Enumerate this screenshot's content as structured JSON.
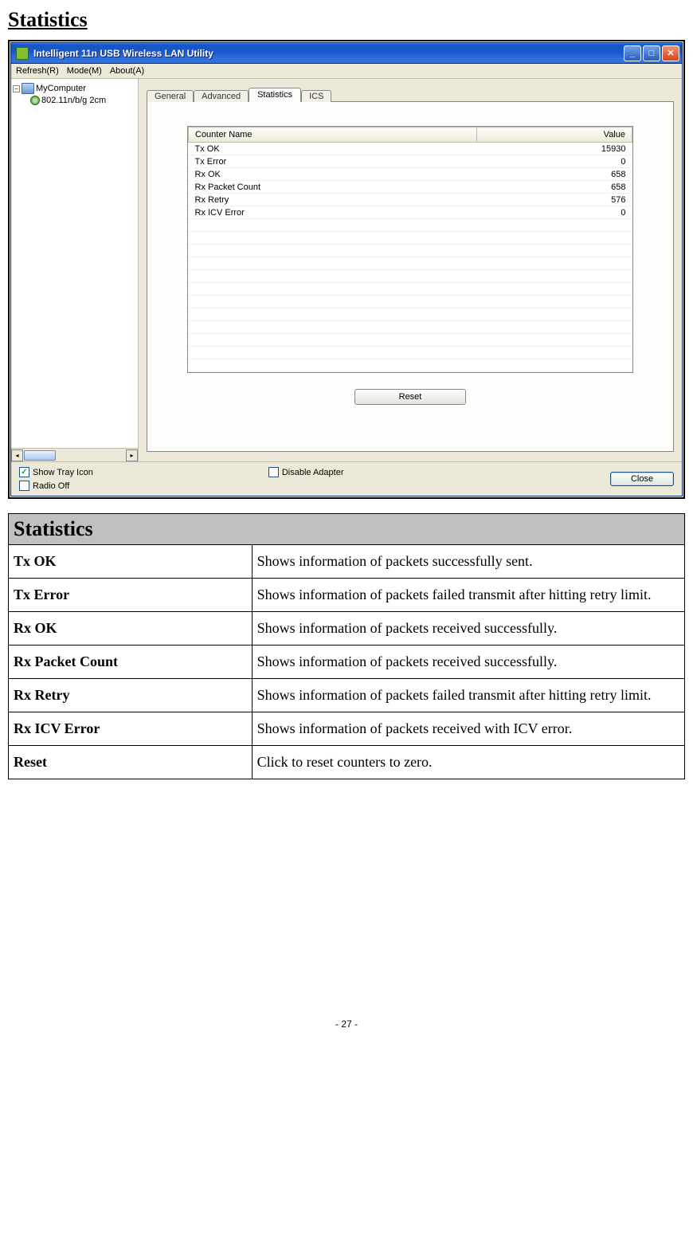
{
  "page": {
    "heading": "Statistics",
    "pageNumber": "- 27 -"
  },
  "window": {
    "title": "Intelligent 11n USB Wireless LAN Utility",
    "menus": [
      "Refresh(R)",
      "Mode(M)",
      "About(A)"
    ],
    "tree": {
      "root": "MyComputer",
      "child": "802.11n/b/g 2cm"
    },
    "tabs": [
      "General",
      "Advanced",
      "Statistics",
      "ICS"
    ],
    "activeTab": "Statistics",
    "statHeaders": {
      "name": "Counter Name",
      "value": "Value"
    },
    "stats": [
      {
        "name": "Tx OK",
        "value": "15930"
      },
      {
        "name": "Tx Error",
        "value": "0"
      },
      {
        "name": "Rx OK",
        "value": "658"
      },
      {
        "name": "Rx Packet Count",
        "value": "658"
      },
      {
        "name": "Rx Retry",
        "value": "576"
      },
      {
        "name": "Rx ICV Error",
        "value": "0"
      }
    ],
    "resetLabel": "Reset",
    "checkboxes": {
      "showTray": {
        "label": "Show Tray Icon",
        "checked": true
      },
      "radioOff": {
        "label": "Radio Off",
        "checked": false
      },
      "disableAdapter": {
        "label": "Disable Adapter",
        "checked": false
      }
    },
    "closeLabel": "Close"
  },
  "descTable": {
    "header": "Statistics",
    "rows": [
      {
        "key": "Tx OK",
        "desc": "Shows information of packets successfully sent."
      },
      {
        "key": "Tx Error",
        "desc": "Shows information of packets failed transmit after hitting retry limit."
      },
      {
        "key": "Rx OK",
        "desc": "Shows information of packets received successfully."
      },
      {
        "key": "Rx Packet Count",
        "desc": "Shows information of packets received successfully."
      },
      {
        "key": "Rx Retry",
        "desc": "Shows information of packets failed transmit after hitting retry limit."
      },
      {
        "key": "Rx ICV Error",
        "desc": "Shows information of packets received with ICV error."
      },
      {
        "key": "Reset",
        "desc": "Click to reset counters to zero."
      }
    ]
  }
}
